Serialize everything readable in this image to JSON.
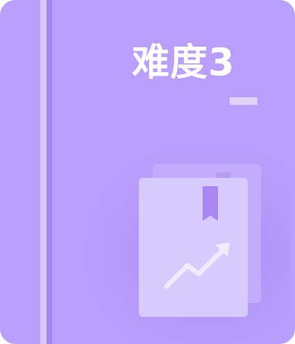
{
  "card": {
    "title": "难度3"
  },
  "icons": {
    "book": "book-with-bookmark-icon",
    "trend": "trend-up-arrow-icon"
  },
  "colors": {
    "background": "#b99ffb",
    "spine_light": "#d6c7fd",
    "spine_dark": "#a484f2",
    "title": "#ffffff",
    "book_front": "#d8c9fe",
    "book_back": "#c4aefc"
  }
}
